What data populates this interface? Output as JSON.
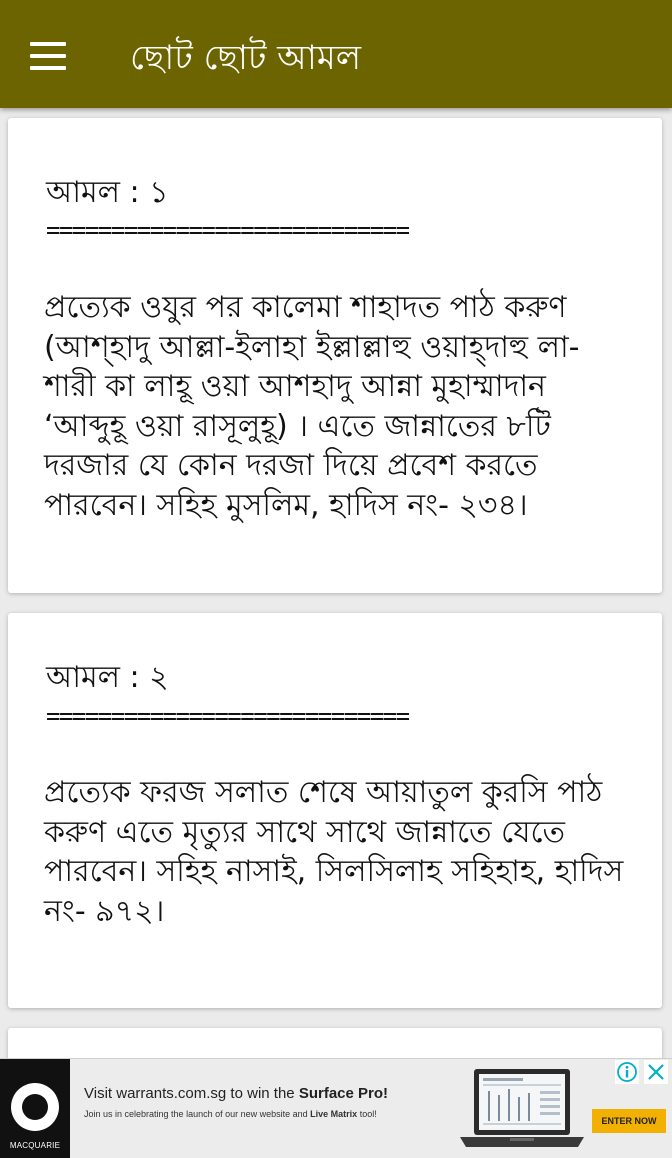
{
  "app_bar": {
    "title": "ছোট ছোট আমল",
    "menu_icon": "hamburger-menu-icon"
  },
  "cards": [
    {
      "title": "আমল : ১",
      "separator": "============================",
      "body": "প্রত্যেক ওযুর পর কালেমা শাহাদত পাঠ করুণ (আশ্হাদু আল্লা-ইলাহা ইল্লাল্লাহু ওয়াহ্দাহু লা- শারী কা লাহূ ওয়া আশহাদু আন্না মুহাম্মাদান ‘আব্দুহূ ওয়া রাসূলুহূ) ।  এতে জান্নাতের ৮টি দরজার যে কোন দরজা দিয়ে প্রবেশ করতে পারবেন। সহিহ মুসলিম, হাদিস নং- ২৩৪।"
    },
    {
      "title": "আমল : ২",
      "separator": "============================",
      "body": "প্রত্যেক ফরজ সলাত শেষে আয়াতুল কুরসি পাঠ করুণ এতে মৃত্যুর সাথে সাথে জান্নাতে যেতে পারবেন। সহিহ নাসাই, সিলসিলাহ সহিহাহ, হাদিস নং- ৯৭২।"
    }
  ],
  "ad": {
    "logo_text": "MACQUARIE",
    "headline_prefix": "Visit warrants.com.sg to win the ",
    "headline_bold": "Surface Pro!",
    "sub_prefix": "Join us in celebrating the launch of our new website and ",
    "sub_bold": "Live Matrix",
    "sub_suffix": " tool!",
    "cta": "ENTER NOW",
    "info_icon": "info-icon",
    "close_icon": "close-icon",
    "accent": "#f2b100",
    "info_color": "#00aecd"
  },
  "colors": {
    "app_bar": "#6b6400",
    "background": "#ebebeb",
    "card": "#ffffff"
  }
}
